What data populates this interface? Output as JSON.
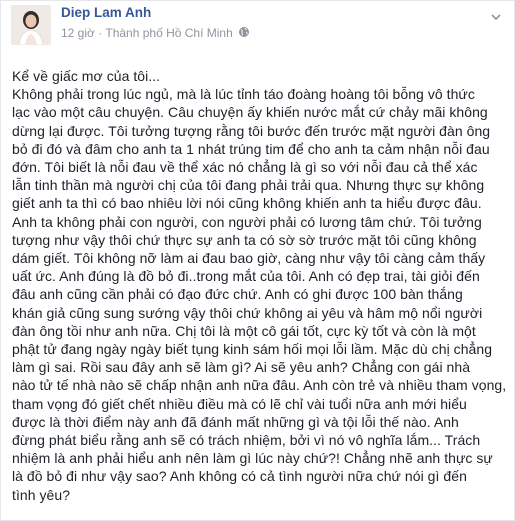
{
  "post": {
    "author": "Diep Lam Anh",
    "time": "12 giờ",
    "separator": "·",
    "location": "Thành phố Hồ Chí Minh",
    "lines": [
      "Kể về giấc mơ của tôi...",
      "Không phải trong lúc ngủ, mà là lúc tỉnh táo đoàng hoàng tôi bỗng vô thức",
      "lạc vào một câu chuyện. Câu chuyện ấy khiến nước mắt cứ chảy mãi không",
      "dừng lại được. Tôi tưởng tượng rằng tôi bước đến trước mặt người đàn ông",
      "bỏ đi đó và đâm cho anh ta 1 nhát trúng tim để cho anh ta cảm nhận nỗi đau",
      "đớn. Tôi biết là nỗi đau về thể xác nó chẳng là gì so với nỗi đau cả thể xác",
      "lẫn tinh thần mà người chị của tôi đang phải trải qua. Nhưng thực sự không",
      "giết anh ta thì có bao nhiêu lời nói cũng không khiến anh ta hiểu được đâu.",
      "Anh ta không phải con người, con người phải có lương tâm chứ. Tôi tưởng",
      "tượng như vậy thôi chứ thực sự anh ta có sờ sờ trước mặt tôi cũng không",
      "dám giết. Tôi không nỡ làm ai đau bao giờ, càng như vậy tôi càng cảm thấy",
      "uất ức. Anh đúng là đồ bỏ đi..trong mắt của tôi. Anh có đẹp trai, tài giỏi đến",
      "đâu anh cũng cần phải có đạo đức chứ. Anh có ghi được 100 bàn thắng",
      "khán giả cũng sung sướng vậy thôi chứ không ai yêu và hâm mộ nổi người",
      "đàn ông tồi như anh nữa. Chị tôi là một cô gái tốt, cực kỳ tốt và còn là một",
      "phật tử đang ngày ngày biết tụng kinh sám hối mọi lỗi lầm. Mặc dù chị chẳng",
      "làm gì sai. Rồi sau đây anh sẽ làm gì? Ai sẽ yêu anh? Chẳng con gái nhà",
      "nào tử tế nhà nào sẽ chấp nhận anh nữa đâu. Anh còn trẻ và nhiều tham vọng,",
      "tham vọng đó giết chết nhiều điều mà có lẽ chỉ vài tuổi nữa anh mới hiểu",
      "được là thời điểm này anh đã đánh mất những gì và tội lỗi thế nào. Anh",
      "đừng phát biểu rằng anh sẽ có trách nhiệm, bởi vì nó vô nghĩa lắm... Trách",
      "nhiệm là anh phải hiểu anh nên làm gì lúc này chứ?! Chẳng nhẽ anh thực sự",
      "là đồ bỏ đi như vậy sao? Anh không có cả tình người nữa chứ nói gì đến",
      "tình yêu?"
    ]
  },
  "icons": {
    "globe": "globe-icon",
    "chevron": "chevron-down-icon"
  },
  "colors": {
    "author": "#365899",
    "meta": "#90949c",
    "text": "#1d2129"
  }
}
